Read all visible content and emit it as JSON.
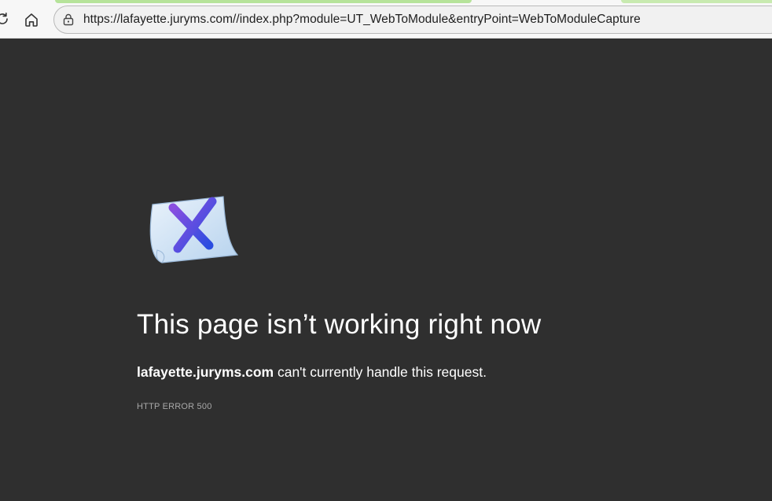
{
  "browser": {
    "url": "https://lafayette.juryms.com//index.php?module=UT_WebToModule&entryPoint=WebToModuleCapture",
    "reload_icon": "reload-icon",
    "home_icon": "home-icon",
    "site_info_icon": "lock-icon"
  },
  "error_page": {
    "icon": "error-document-x-icon",
    "headline": "This page isn’t working right now",
    "host": "lafayette.juryms.com",
    "message_rest": " can't currently handle this request.",
    "error_code": "HTTP ERROR 500"
  },
  "colors": {
    "page_background": "#2f2f2f",
    "toolbar_background": "#f7f7f7",
    "text_primary": "#ffffff",
    "text_secondary": "#a8a8a8",
    "icon_x_gradient_start": "#8a4fe0",
    "icon_x_gradient_end": "#2b4de0"
  }
}
